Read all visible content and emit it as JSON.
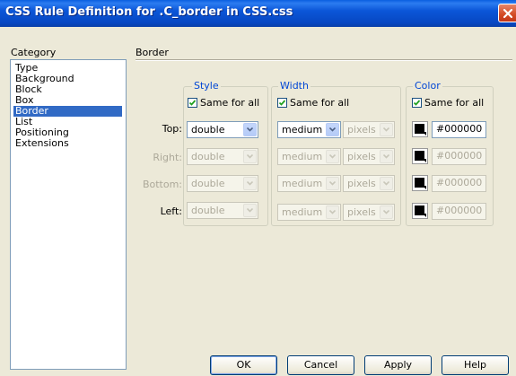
{
  "window": {
    "title": "CSS Rule Definition for .C_border in CSS.css"
  },
  "category": {
    "label": "Category",
    "items": [
      "Type",
      "Background",
      "Block",
      "Box",
      "Border",
      "List",
      "Positioning",
      "Extensions"
    ],
    "selected": "Border"
  },
  "section": {
    "title": "Border"
  },
  "style": {
    "legend": "Style",
    "same_for_all": "Same for all",
    "same_checked": true,
    "top": "double",
    "right": "double",
    "bottom": "double",
    "left": "double"
  },
  "width": {
    "legend": "Width",
    "same_for_all": "Same for all",
    "same_checked": true,
    "top": "medium",
    "right": "medium",
    "bottom": "medium",
    "left": "medium",
    "unit": "pixels"
  },
  "color": {
    "legend": "Color",
    "same_for_all": "Same for all",
    "same_checked": true,
    "top": "#000000",
    "right": "#000000",
    "bottom": "#000000",
    "left": "#000000",
    "swatch_color": "#000000"
  },
  "rows": {
    "top": "Top:",
    "right": "Right:",
    "bottom": "Bottom:",
    "left": "Left:"
  },
  "buttons": {
    "ok": "OK",
    "cancel": "Cancel",
    "apply": "Apply",
    "help": "Help"
  },
  "colors": {
    "titlebar": "#0747c2",
    "selection": "#316ac5",
    "legend_text": "#0046d5",
    "disabled_text": "#aca899",
    "face": "#ece9d8"
  }
}
